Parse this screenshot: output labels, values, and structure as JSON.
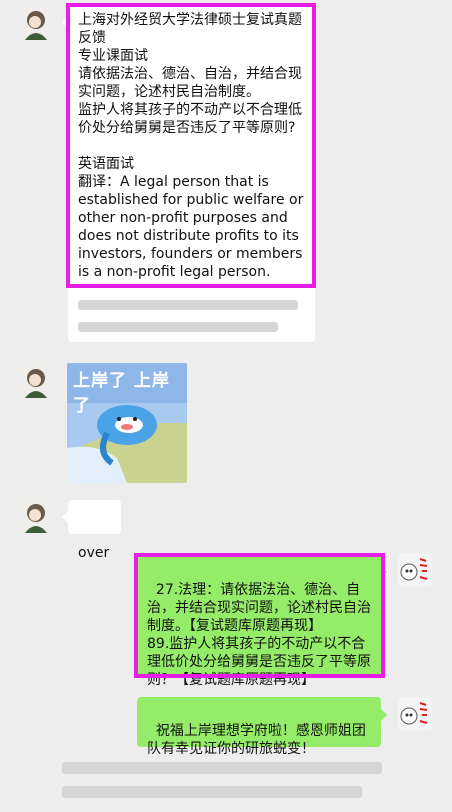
{
  "messages": {
    "m1": {
      "text": "上海对外经贸大学法律硕士复试真题反馈\n专业课面试\n请依据法治、德治、自治，并结合现实问题，论述村民自治制度。\n监护人将其孩子的不动产以不合理低价处分给舅舅是否违反了平等原则?\n\n英语面试\n翻译：A legal person that is established for public welfare or other non-profit purposes and does not distribute profits to its investors, founders or members is a non-profit legal person."
    },
    "sticker": {
      "caption": "上岸了 上岸了"
    },
    "m3": {
      "text": "over"
    },
    "m4": {
      "text": "27.法理：请依据法治、德治、自治，并结合现实问题，论述村民自治制度。【复试题库原题再现】\n89.监护人将其孩子的不动产以不合理低价处分给舅舅是否违反了平等原则？【复试题库原题再现】"
    },
    "m5": {
      "text": "祝福上岸理想学府啦！感恩师姐团队有幸见证你的研旅蜕变！"
    }
  },
  "colors": {
    "background": "#ededed",
    "incoming_bubble": "#ffffff",
    "outgoing_bubble": "#95ec69",
    "highlight_border": "#e61ee6"
  }
}
